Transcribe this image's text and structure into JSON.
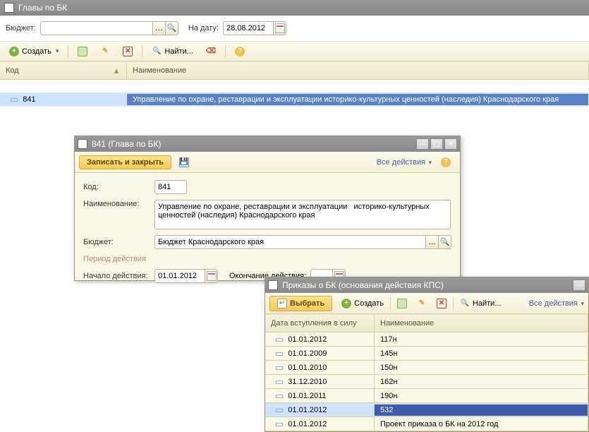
{
  "main": {
    "title": "Главы по БК",
    "budget_label": "Бюджет:",
    "budget_value": "",
    "date_label": "На дату:",
    "date_value": "28.08.2012"
  },
  "toolbar": {
    "create": "Создать",
    "find": "Найти..."
  },
  "columns": {
    "code": "Код",
    "name": "Наименование"
  },
  "row": {
    "code": "841",
    "name": "Управление по охране, реставрации и эксплуатации   историко-культурных ценностей (наследия) Краснодарского края"
  },
  "dialog": {
    "title": "841 (Глава по БК)",
    "save_close": "Записать и закрыть",
    "all_actions": "Все действия",
    "code_label": "Код:",
    "code_value": "841",
    "name_label": "Наименование:",
    "name_value": "Управление по охране, реставрации и эксплуатации   историко-культурных ценностей (наследия) Краснодарского края",
    "budget_label": "Бюджет:",
    "budget_value": "Бюджет Краснодарского края",
    "period_label": "Период действия",
    "start_label": "Начало действия:",
    "start_value": "01.01.2012",
    "end_label": "Окончание действия:",
    "end_value": ". ."
  },
  "orders": {
    "title": "Приказы о БК (основания действия КПС)",
    "select": "Выбрать",
    "create": "Создать",
    "find": "Найти...",
    "all_actions": "Все действия",
    "col_date": "Дата вступления в силу",
    "col_name": "Наименование",
    "rows": [
      {
        "date": "01.01.2012",
        "name": "117н"
      },
      {
        "date": "01.01.2009",
        "name": "145н"
      },
      {
        "date": "01.01.2010",
        "name": "150н"
      },
      {
        "date": "31.12.2010",
        "name": "162н"
      },
      {
        "date": "01.01.2011",
        "name": "190н"
      },
      {
        "date": "01.01.2012",
        "name": "532"
      },
      {
        "date": "01.01.2012",
        "name": "Проект приказа о БК на 2012 год"
      }
    ],
    "selected_index": 5
  }
}
